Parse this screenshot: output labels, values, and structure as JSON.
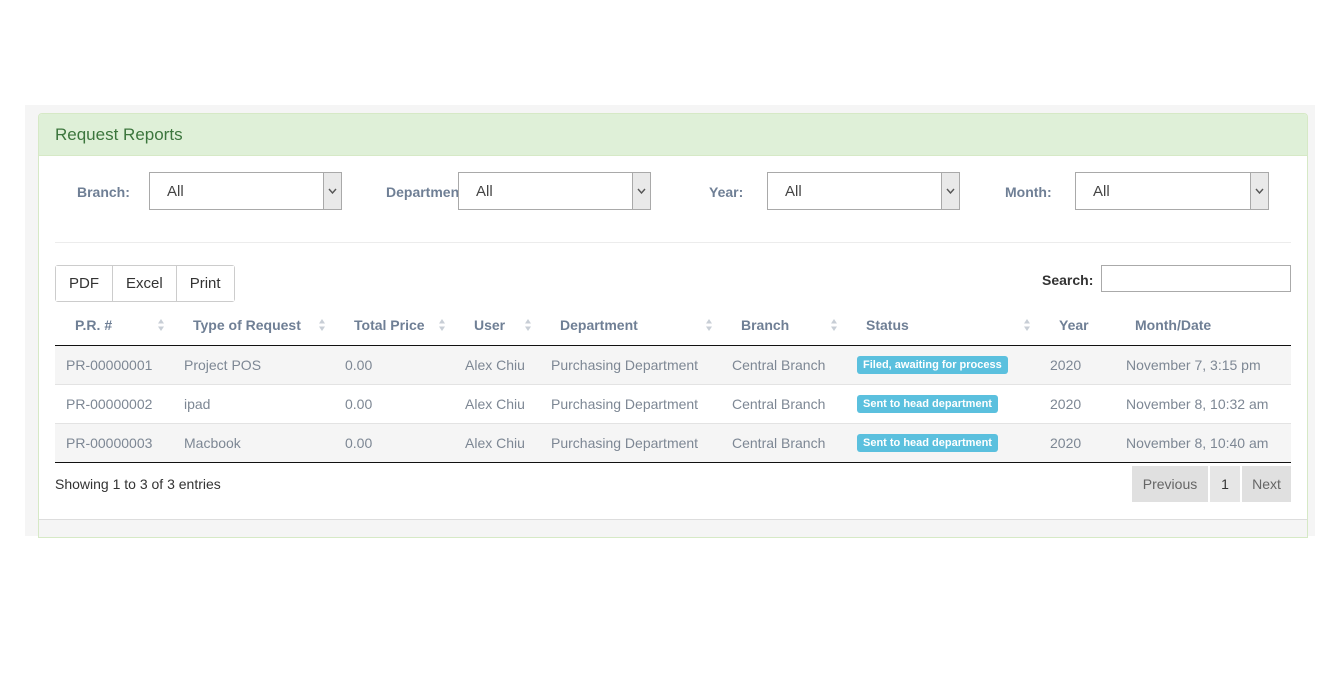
{
  "panel": {
    "title": "Request Reports"
  },
  "filters": [
    {
      "label": "Branch:",
      "value": "All"
    },
    {
      "label": "Department:",
      "value": "All"
    },
    {
      "label": "Year:",
      "value": "All"
    },
    {
      "label": "Month:",
      "value": "All"
    }
  ],
  "export_buttons": [
    "PDF",
    "Excel",
    "Print"
  ],
  "search": {
    "label": "Search:",
    "value": ""
  },
  "table": {
    "columns": [
      "P.R. #",
      "Type of Request",
      "Total Price",
      "User",
      "Department",
      "Branch",
      "Status",
      "Year",
      "Month/Date"
    ],
    "rows": [
      {
        "pr": "PR-00000001",
        "type": "Project POS",
        "price": "0.00",
        "user": "Alex Chiu",
        "department": "Purchasing Department",
        "branch": "Central Branch",
        "status": "Filed, awaiting for process",
        "year": "2020",
        "date": "November 7, 3:15 pm"
      },
      {
        "pr": "PR-00000002",
        "type": "ipad",
        "price": "0.00",
        "user": "Alex Chiu",
        "department": "Purchasing Department",
        "branch": "Central Branch",
        "status": "Sent to head department",
        "year": "2020",
        "date": "November 8, 10:32 am"
      },
      {
        "pr": "PR-00000003",
        "type": "Macbook",
        "price": "0.00",
        "user": "Alex Chiu",
        "department": "Purchasing Department",
        "branch": "Central Branch",
        "status": "Sent to head department",
        "year": "2020",
        "date": "November 8, 10:40 am"
      }
    ]
  },
  "info": "Showing 1 to 3 of 3 entries",
  "pagination": {
    "previous": "Previous",
    "current": "1",
    "next": "Next"
  },
  "colors": {
    "heading_bg": "#dff0d8",
    "heading_text": "#3c763d",
    "badge": "#5bc0de"
  }
}
